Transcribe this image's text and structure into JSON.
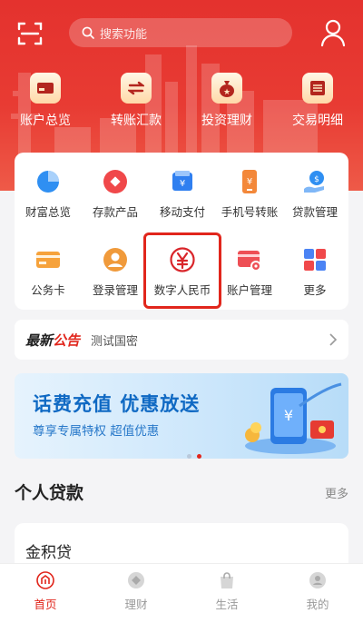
{
  "header": {
    "search_placeholder": "搜索功能"
  },
  "quick_actions": [
    {
      "label": "账户总览",
      "icon": "wallet-icon"
    },
    {
      "label": "转账汇款",
      "icon": "transfer-icon"
    },
    {
      "label": "投资理财",
      "icon": "money-bag-icon"
    },
    {
      "label": "交易明细",
      "icon": "list-detail-icon"
    }
  ],
  "services": [
    {
      "label": "财富总览",
      "icon": "pie-chart-icon",
      "color": "#2f8ff2"
    },
    {
      "label": "存款产品",
      "icon": "diamond-coin-icon",
      "color": "#f0484a"
    },
    {
      "label": "移动支付",
      "icon": "mobile-pay-icon",
      "color": "#2f7ff0"
    },
    {
      "label": "手机号转账",
      "icon": "phone-transfer-icon",
      "color": "#f3883a"
    },
    {
      "label": "贷款管理",
      "icon": "loan-hand-icon",
      "color": "#2f8ff2"
    },
    {
      "label": "公务卡",
      "icon": "card-icon",
      "color": "#f6a23b"
    },
    {
      "label": "登录管理",
      "icon": "user-circle-icon",
      "color": "#f09a3b"
    },
    {
      "label": "数字人民币",
      "icon": "digital-rmb-icon",
      "color": "#d9252a"
    },
    {
      "label": "账户管理",
      "icon": "account-settings-icon",
      "color": "#ee4f55"
    },
    {
      "label": "更多",
      "icon": "grid-more-icon",
      "color": "#4b83f4"
    }
  ],
  "notice": {
    "tag_part1": "最新",
    "tag_part2": "公告",
    "text": "测试国密"
  },
  "banner": {
    "title": "话费充值 优惠放送",
    "subtitle": "尊享专属特权 超值优惠"
  },
  "personal_loans": {
    "title": "个人贷款",
    "more": "更多",
    "first_card_title": "金积贷"
  },
  "tabbar": [
    {
      "label": "首页",
      "icon": "home-icon",
      "active": true
    },
    {
      "label": "理财",
      "icon": "finance-icon",
      "active": false
    },
    {
      "label": "生活",
      "icon": "shopping-bag-icon",
      "active": false
    },
    {
      "label": "我的",
      "icon": "profile-icon",
      "active": false
    }
  ],
  "colors": {
    "brand_red": "#e1261c",
    "banner_blue": "#0f69c3"
  }
}
